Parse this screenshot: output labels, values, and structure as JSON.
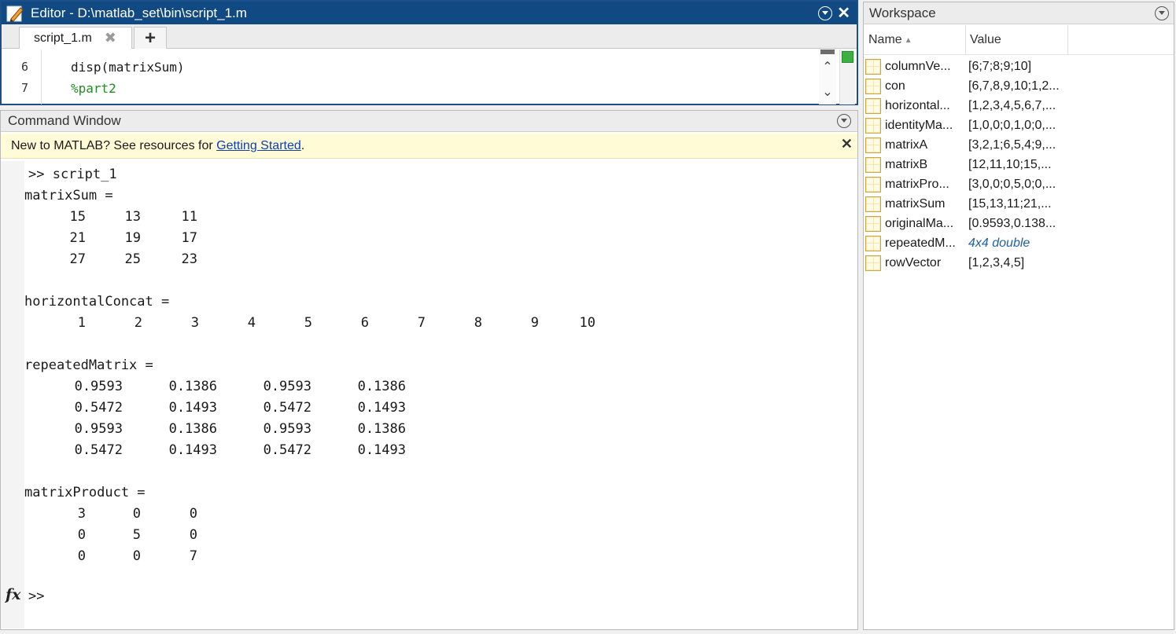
{
  "editor": {
    "title": "Editor - D:\\matlab_set\\bin\\script_1.m",
    "tab_label": "script_1.m",
    "tab_close": "✖",
    "add_tab": "+",
    "lines": [
      {
        "num": "6",
        "text": "disp(matrixSum)",
        "kind": "code"
      },
      {
        "num": "7",
        "text": "%part2",
        "kind": "comment"
      }
    ]
  },
  "command_window": {
    "title": "Command Window",
    "banner_prefix": "New to MATLAB? See resources for ",
    "banner_link": "Getting Started",
    "banner_suffix": ".",
    "command": ">> script_1",
    "outputs": [
      {
        "name": "matrixSum =",
        "rows": [
          [
            "15",
            "13",
            "11"
          ],
          [
            "21",
            "19",
            "17"
          ],
          [
            "27",
            "25",
            "23"
          ]
        ]
      },
      {
        "name": "horizontalConcat =",
        "rows": [
          [
            "1",
            "2",
            "3",
            "4",
            "5",
            "6",
            "7",
            "8",
            "9",
            "10"
          ]
        ]
      },
      {
        "name": "repeatedMatrix =",
        "rows": [
          [
            "0.9593",
            "0.1386",
            "0.9593",
            "0.1386"
          ],
          [
            "0.5472",
            "0.1493",
            "0.5472",
            "0.1493"
          ],
          [
            "0.9593",
            "0.1386",
            "0.9593",
            "0.1386"
          ],
          [
            "0.5472",
            "0.1493",
            "0.5472",
            "0.1493"
          ]
        ]
      },
      {
        "name": "matrixProduct =",
        "rows": [
          [
            "3",
            "0",
            "0"
          ],
          [
            "0",
            "5",
            "0"
          ],
          [
            "0",
            "0",
            "7"
          ]
        ]
      }
    ],
    "fx_label": "fx",
    "prompt": ">>"
  },
  "workspace": {
    "title": "Workspace",
    "col_name": "Name",
    "col_value": "Value",
    "variables": [
      {
        "name": "columnVe...",
        "value": "[6;7;8;9;10]",
        "italic": false
      },
      {
        "name": "con",
        "value": "[6,7,8,9,10;1,2...",
        "italic": false
      },
      {
        "name": "horizontal...",
        "value": "[1,2,3,4,5,6,7,...",
        "italic": false
      },
      {
        "name": "identityMa...",
        "value": "[1,0,0;0,1,0;0,...",
        "italic": false
      },
      {
        "name": "matrixA",
        "value": "[3,2,1;6,5,4;9,...",
        "italic": false
      },
      {
        "name": "matrixB",
        "value": "[12,11,10;15,...",
        "italic": false
      },
      {
        "name": "matrixPro...",
        "value": "[3,0,0;0,5,0;0,...",
        "italic": false
      },
      {
        "name": "matrixSum",
        "value": "[15,13,11;21,...",
        "italic": false
      },
      {
        "name": "originalMa...",
        "value": "[0.9593,0.138...",
        "italic": false
      },
      {
        "name": "repeatedM...",
        "value": "4x4 double",
        "italic": true
      },
      {
        "name": "rowVector",
        "value": "[1,2,3,4,5]",
        "italic": false
      }
    ]
  },
  "icons": {
    "editor_icon": "pen-icon",
    "minimize": "chevron-down-circle-icon",
    "close": "close-icon",
    "variable": "matrix-grid-icon"
  },
  "colors": {
    "editor_titlebar": "#114a82",
    "comment": "#228b22",
    "link": "#0c3fb0",
    "banner_bg": "#fffbd6",
    "status_ok": "#3cb043"
  }
}
